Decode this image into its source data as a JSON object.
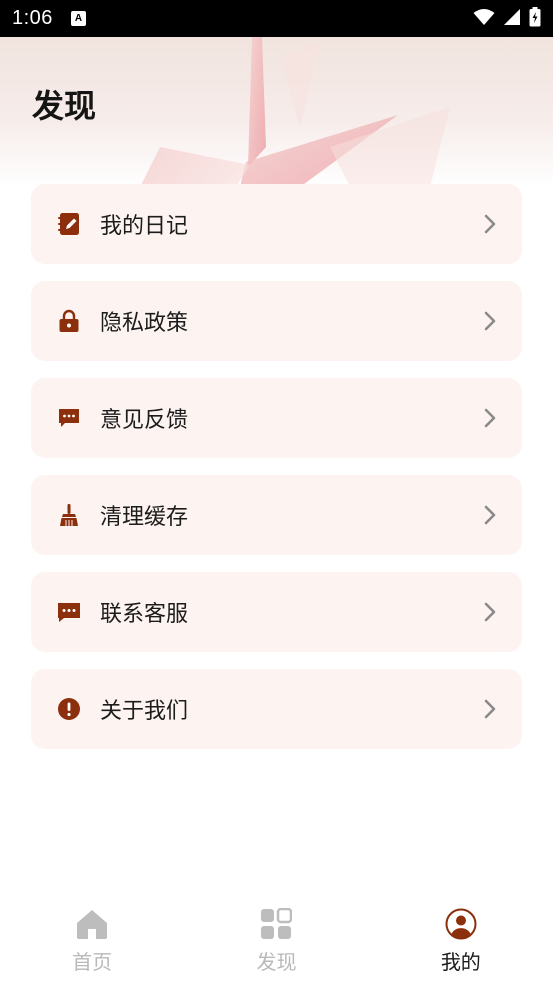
{
  "status_bar": {
    "time": "1:06",
    "notification_glyph": "A"
  },
  "header": {
    "title": "发现"
  },
  "menu": {
    "items": [
      {
        "label": "我的日记",
        "icon": "diary-icon"
      },
      {
        "label": "隐私政策",
        "icon": "lock-icon"
      },
      {
        "label": "意见反馈",
        "icon": "feedback-chat-icon"
      },
      {
        "label": "清理缓存",
        "icon": "broom-icon"
      },
      {
        "label": "联系客服",
        "icon": "support-chat-icon"
      },
      {
        "label": "关于我们",
        "icon": "info-alert-icon"
      }
    ]
  },
  "tabbar": {
    "tabs": [
      {
        "label": "首页",
        "icon": "home-icon",
        "active": false
      },
      {
        "label": "发现",
        "icon": "grid-icon",
        "active": false
      },
      {
        "label": "我的",
        "icon": "profile-icon",
        "active": true
      }
    ]
  },
  "colors": {
    "accent": "#8b2f0c",
    "card_bg": "#fdf3f0",
    "inactive_tab": "#b9b9b9",
    "chevron": "#8a8a8a"
  }
}
